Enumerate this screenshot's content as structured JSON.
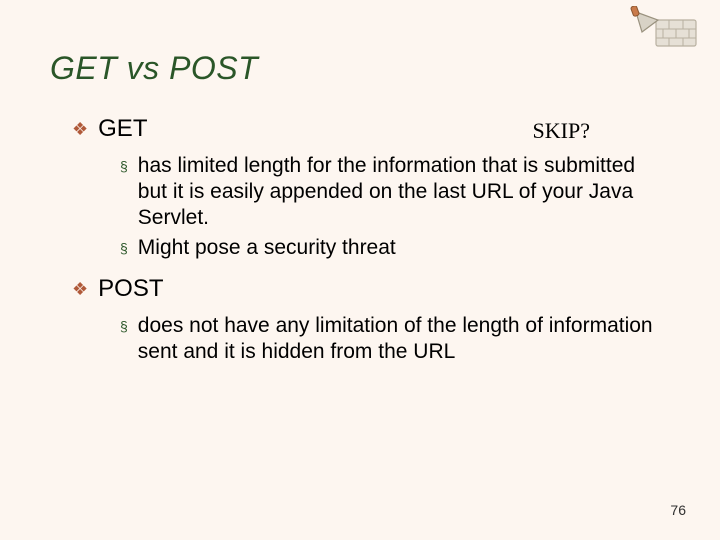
{
  "title": "GET vs POST",
  "skip_label": "SKIP?",
  "sections": [
    {
      "heading": "GET",
      "items": [
        "has limited length for the information that is submitted but it is easily appended on the last URL of your Java Servlet.",
        "Might pose a security threat"
      ]
    },
    {
      "heading": "POST",
      "items": [
        "does not have any limitation of the length of information sent and it is hidden from the URL"
      ]
    }
  ],
  "page_number": "76"
}
